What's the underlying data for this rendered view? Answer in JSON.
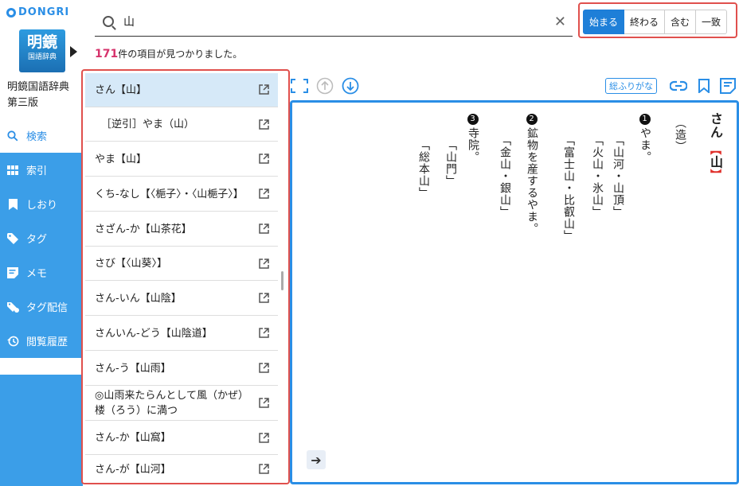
{
  "brand": {
    "logo": "DONGRI"
  },
  "dictionary": {
    "cover_title": "明鏡",
    "cover_sub": "国語辞典",
    "name_line1": "明鏡国語辞典",
    "name_line2": "第三版"
  },
  "nav": [
    {
      "label": "検索",
      "icon": "search-icon"
    },
    {
      "label": "索引",
      "icon": "grid-icon"
    },
    {
      "label": "しおり",
      "icon": "bookmark-icon"
    },
    {
      "label": "タグ",
      "icon": "tag-icon"
    },
    {
      "label": "メモ",
      "icon": "memo-icon"
    },
    {
      "label": "タグ配信",
      "icon": "tag-share-icon"
    },
    {
      "label": "閲覧履歴",
      "icon": "history-icon"
    }
  ],
  "search": {
    "value": "山"
  },
  "modes": {
    "items": [
      "始まる",
      "終わる",
      "含む",
      "一致"
    ],
    "selected": "始まる"
  },
  "result": {
    "count": "171",
    "suffix": "件の項目が見つかりました。"
  },
  "list": [
    "さん【山】",
    "［逆引］やま（山）",
    "やま【山】",
    "くち-なし【〈梔子〉・〈山梔子〉】",
    "さざん-か【山茶花】",
    "さび【〈山葵〉】",
    "さん-いん【山陰】",
    "さんいん-どう【山陰道】",
    "さん-う【山雨】",
    "◎山雨来たらんとして風（かぜ）楼（ろう）に満つ",
    "さん-か【山窩】",
    "さん-が【山河】"
  ],
  "toolbar": {
    "furigana": "総ふりがな"
  },
  "entry": {
    "reading": "さん",
    "kanji": "山",
    "origin": "（造）",
    "sense1_num": "1",
    "sense1_def": "やま。",
    "sense1_ex1": "「山河・山頂」",
    "sense1_ex2": "「火山・氷山」",
    "sense1_ex3": "「富士山・比叡山」",
    "sense2_num": "2",
    "sense2_def": "鉱物を産するやま。",
    "sense2_ex1": "「金山・銀山」",
    "sense3_num": "3",
    "sense3_def": "寺院。",
    "sense3_ex1": "「山門」",
    "sense3_ex2": "「総本山」"
  },
  "colors": {
    "accent": "#2a8ee6",
    "sidebar": "#3b9ee8",
    "highlight_border": "#e0504d",
    "count": "#d6336c",
    "selected_row": "#d6e9f8"
  }
}
